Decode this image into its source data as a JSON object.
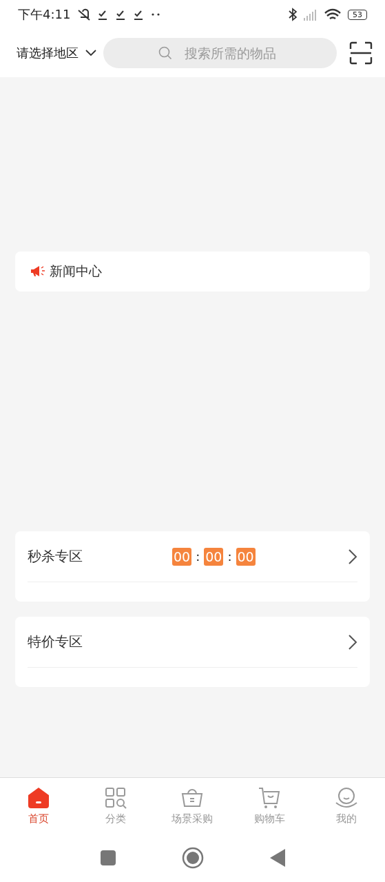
{
  "status_bar": {
    "time": "下午4:11",
    "battery": "53"
  },
  "header": {
    "region": "请选择地区",
    "search": {
      "placeholder": "搜索所需的物品"
    }
  },
  "news": {
    "title": "新闻中心"
  },
  "sections": [
    {
      "title": "秒杀专区",
      "countdown": [
        "00",
        "00",
        "00"
      ],
      "separator": ":"
    },
    {
      "title": "特价专区"
    }
  ],
  "tabs": [
    {
      "label": "首页",
      "selected": true
    },
    {
      "label": "分类",
      "selected": false
    },
    {
      "label": "场景采购",
      "selected": false
    },
    {
      "label": "购物车",
      "selected": false
    },
    {
      "label": "我的",
      "selected": false
    }
  ]
}
